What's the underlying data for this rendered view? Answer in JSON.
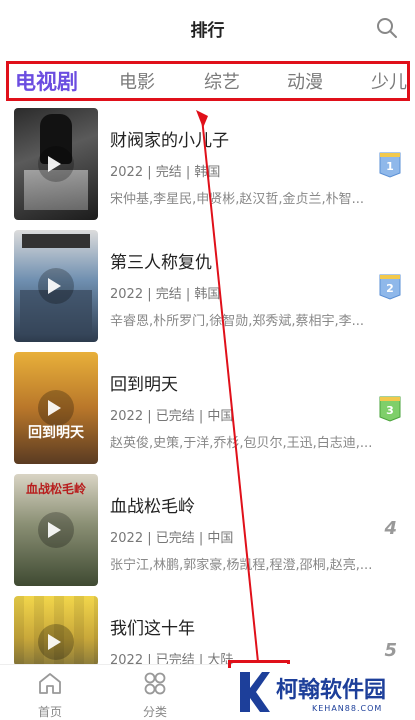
{
  "header": {
    "title": "排行",
    "search_icon": "search-icon"
  },
  "tabs": [
    {
      "label": "电视剧",
      "active": true
    },
    {
      "label": "电影",
      "active": false
    },
    {
      "label": "综艺",
      "active": false
    },
    {
      "label": "动漫",
      "active": false
    },
    {
      "label": "少儿",
      "active": false
    }
  ],
  "items": [
    {
      "title": "财阀家的小儿子",
      "meta": "2022 | 完结 | 韩国",
      "cast": "宋仲基,李星民,申贤彬,赵汉哲,金贞兰,朴智...",
      "rank": "1"
    },
    {
      "title": "第三人称复仇",
      "meta": "2022 | 完结 | 韩国",
      "cast": "辛睿恩,朴所罗门,徐智勋,郑秀斌,蔡相宇,李...",
      "rank": "2"
    },
    {
      "title": "回到明天",
      "meta": "2022 | 已完结 | 中国",
      "cast": "赵英俊,史策,于洋,乔杉,包贝尔,王迅,白志迪,...",
      "rank": "3"
    },
    {
      "title": "血战松毛岭",
      "meta": "2022 | 已完结 | 中国",
      "cast": "张宁江,林鹏,郭家豪,杨凯程,程澄,邵桐,赵亮,...",
      "rank": "4"
    },
    {
      "title": "我们这十年",
      "meta": "2022 | 已完结 | 大陆",
      "cast": "",
      "rank": "5"
    }
  ],
  "posters": [
    "回到明天",
    "血战松毛岭"
  ],
  "bottom_nav": [
    {
      "label": "首页",
      "icon": "home-icon"
    },
    {
      "label": "分类",
      "icon": "category-icon"
    }
  ],
  "watermark": {
    "name": "柯翰软件园",
    "domain": "KEHAN88.COM"
  },
  "colors": {
    "accent": "#6b4de0",
    "annotation": "#e0101a",
    "watermark": "#1d3f9a"
  }
}
